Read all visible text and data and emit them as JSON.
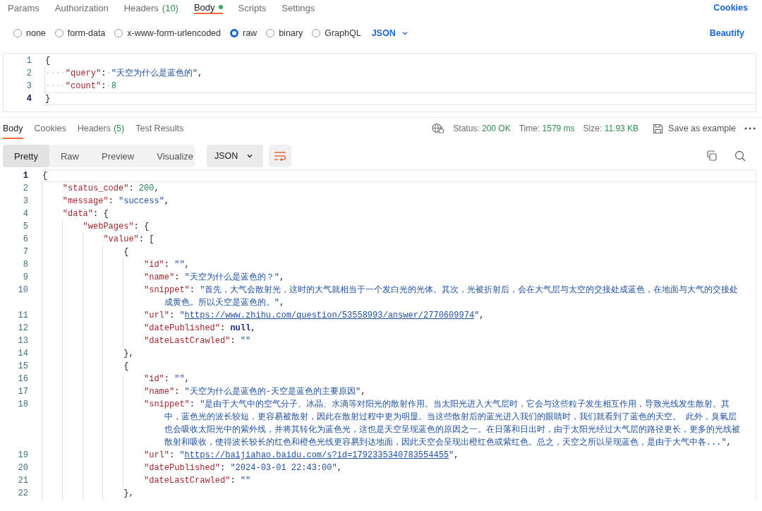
{
  "request_tabs": [
    {
      "label": "Params",
      "selected": false,
      "modified": false
    },
    {
      "label": "Authorization",
      "selected": false,
      "modified": false
    },
    {
      "label": "Headers",
      "count": "(10)",
      "selected": false,
      "modified": false
    },
    {
      "label": "Body",
      "selected": true,
      "modified": true
    },
    {
      "label": "Scripts",
      "selected": false,
      "modified": false
    },
    {
      "label": "Settings",
      "selected": false,
      "modified": false
    }
  ],
  "cookies_link": "Cookies",
  "body_types": [
    {
      "label": "none",
      "selected": false
    },
    {
      "label": "form-data",
      "selected": false
    },
    {
      "label": "x-www-form-urlencoded",
      "selected": false
    },
    {
      "label": "raw",
      "selected": true
    },
    {
      "label": "binary",
      "selected": false
    },
    {
      "label": "GraphQL",
      "selected": false
    }
  ],
  "body_format": "JSON",
  "beautify": "Beautify",
  "request_body": {
    "lines": [
      {
        "number": "1",
        "active": false,
        "tokens": [
          {
            "kind": "punct",
            "text": "{"
          }
        ]
      },
      {
        "number": "2",
        "active": false,
        "tokens": [
          {
            "kind": "whitespace",
            "text": "····"
          },
          {
            "kind": "key",
            "text": "\"query\""
          },
          {
            "kind": "punct",
            "text": ":"
          },
          {
            "kind": "whitespace",
            "text": "·"
          },
          {
            "kind": "string",
            "text": "\"天空为什么是蓝色的\""
          },
          {
            "kind": "punct",
            "text": ","
          }
        ]
      },
      {
        "number": "3",
        "active": false,
        "tokens": [
          {
            "kind": "whitespace",
            "text": "····"
          },
          {
            "kind": "key",
            "text": "\"count\""
          },
          {
            "kind": "punct",
            "text": ":"
          },
          {
            "kind": "whitespace",
            "text": "·"
          },
          {
            "kind": "number",
            "text": "8"
          }
        ]
      },
      {
        "number": "4",
        "active": true,
        "tokens": [
          {
            "kind": "punct",
            "text": "}"
          }
        ]
      }
    ]
  },
  "response_tabs": [
    {
      "label": "Body",
      "selected": true
    },
    {
      "label": "Cookies",
      "selected": false
    },
    {
      "label": "Headers",
      "count": "(5)",
      "selected": false
    },
    {
      "label": "Test Results",
      "selected": false
    }
  ],
  "status": {
    "status_label": "Status:",
    "status_value": "200 OK",
    "time_label": "Time:",
    "time_value": "1579 ms",
    "size_label": "Size:",
    "size_value": "11.93 KB"
  },
  "save_as_example": "Save as example",
  "view_modes": [
    {
      "label": "Pretty",
      "selected": true
    },
    {
      "label": "Raw",
      "selected": false
    },
    {
      "label": "Preview",
      "selected": false
    },
    {
      "label": "Visualize",
      "selected": false
    }
  ],
  "response_format": "JSON",
  "response_body": {
    "lines": [
      {
        "number": "1",
        "active": true,
        "tokens": [
          {
            "kind": "punct",
            "text": "{"
          }
        ]
      },
      {
        "number": "2",
        "active": false,
        "tokens": [
          {
            "kind": "key",
            "text": "\"status_code\""
          },
          {
            "kind": "punct",
            "text": ": "
          },
          {
            "kind": "number",
            "text": "200"
          },
          {
            "kind": "punct",
            "text": ","
          }
        ]
      },
      {
        "number": "3",
        "active": false,
        "tokens": [
          {
            "kind": "key",
            "text": "\"message\""
          },
          {
            "kind": "punct",
            "text": ": "
          },
          {
            "kind": "string",
            "text": "\"success\""
          },
          {
            "kind": "punct",
            "text": ","
          }
        ]
      },
      {
        "number": "4",
        "active": false,
        "tokens": [
          {
            "kind": "key",
            "text": "\"data\""
          },
          {
            "kind": "punct",
            "text": ": {"
          }
        ]
      },
      {
        "number": "5",
        "active": false,
        "tokens": [
          {
            "kind": "key",
            "text": "\"webPages\""
          },
          {
            "kind": "punct",
            "text": ": {"
          }
        ]
      },
      {
        "number": "6",
        "active": false,
        "tokens": [
          {
            "kind": "key",
            "text": "\"value\""
          },
          {
            "kind": "punct",
            "text": ": ["
          }
        ]
      },
      {
        "number": "7",
        "active": false,
        "tokens": [
          {
            "kind": "punct",
            "text": "{"
          }
        ]
      },
      {
        "number": "8",
        "active": false,
        "tokens": [
          {
            "kind": "key",
            "text": "\"id\""
          },
          {
            "kind": "punct",
            "text": ": "
          },
          {
            "kind": "string",
            "text": "\"\""
          },
          {
            "kind": "punct",
            "text": ","
          }
        ]
      },
      {
        "number": "9",
        "active": false,
        "tokens": [
          {
            "kind": "key",
            "text": "\"name\""
          },
          {
            "kind": "punct",
            "text": ": "
          },
          {
            "kind": "string",
            "text": "\"天空为什么是蓝色的？\""
          },
          {
            "kind": "punct",
            "text": ","
          }
        ]
      },
      {
        "number": "10",
        "active": false,
        "tokens": [
          {
            "kind": "key",
            "text": "\"snippet\""
          },
          {
            "kind": "punct",
            "text": ": "
          },
          {
            "kind": "string",
            "text": "\"首先，大气会散射光，这时的大气就相当于一个发白光的光体。其次，光被折射后，会在大气层与太空的交接处成蓝色，在地面与大气的交接处"
          }
        ]
      },
      {
        "active": false,
        "tokens": [
          {
            "kind": "string",
            "text": "成黄色。所以天空是蓝色的。\""
          },
          {
            "kind": "punct",
            "text": ","
          }
        ]
      },
      {
        "number": "11",
        "active": false,
        "tokens": [
          {
            "kind": "key",
            "text": "\"url\""
          },
          {
            "kind": "punct",
            "text": ": "
          },
          {
            "kind": "string",
            "text": "\""
          },
          {
            "kind": "link",
            "text": "https://www.zhihu.com/question/53558993/answer/2770609974"
          },
          {
            "kind": "string",
            "text": "\""
          },
          {
            "kind": "punct",
            "text": ","
          }
        ]
      },
      {
        "number": "12",
        "active": false,
        "tokens": [
          {
            "kind": "key",
            "text": "\"datePublished\""
          },
          {
            "kind": "punct",
            "text": ": "
          },
          {
            "kind": "literal",
            "text": "null"
          },
          {
            "kind": "punct",
            "text": ","
          }
        ]
      },
      {
        "number": "13",
        "active": false,
        "tokens": [
          {
            "kind": "key",
            "text": "\"dateLastCrawled\""
          },
          {
            "kind": "punct",
            "text": ": "
          },
          {
            "kind": "string",
            "text": "\"\""
          }
        ]
      },
      {
        "number": "14",
        "active": false,
        "tokens": [
          {
            "kind": "punct",
            "text": "},"
          }
        ]
      },
      {
        "number": "15",
        "active": false,
        "tokens": [
          {
            "kind": "punct",
            "text": "{"
          }
        ]
      },
      {
        "number": "16",
        "active": false,
        "tokens": [
          {
            "kind": "key",
            "text": "\"id\""
          },
          {
            "kind": "punct",
            "text": ": "
          },
          {
            "kind": "string",
            "text": "\"\""
          },
          {
            "kind": "punct",
            "text": ","
          }
        ]
      },
      {
        "number": "17",
        "active": false,
        "tokens": [
          {
            "kind": "key",
            "text": "\"name\""
          },
          {
            "kind": "punct",
            "text": ": "
          },
          {
            "kind": "string",
            "text": "\"天空为什么是蓝色的-天空是蓝色的主要原因\""
          },
          {
            "kind": "punct",
            "text": ","
          }
        ]
      },
      {
        "number": "18",
        "active": false,
        "tokens": [
          {
            "kind": "key",
            "text": "\"snippet\""
          },
          {
            "kind": "punct",
            "text": ": "
          },
          {
            "kind": "string",
            "text": "\"是由于大气中的空气分子、冰晶、水滴等对阳光的散射作用。当太阳光进入大气层时，它会与这些粒子发生相互作用，导致光线发生散射。其"
          }
        ]
      },
      {
        "active": false,
        "tokens": [
          {
            "kind": "string",
            "text": "中，蓝色光的波长较短，更容易被散射，因此在散射过程中更为明显。当这些散射后的蓝光进入我们的眼睛时，我们就看到了蓝色的天空。 此外，臭氧层"
          }
        ]
      },
      {
        "active": false,
        "tokens": [
          {
            "kind": "string",
            "text": "也会吸收太阳光中的紫外线，并将其转化为蓝色光，这也是天空呈现蓝色的原因之一。在日落和日出时，由于太阳光经过大气层的路径更长，更多的光线被"
          }
        ]
      },
      {
        "active": false,
        "tokens": [
          {
            "kind": "string",
            "text": "散射和吸收，使得波长较长的红色和橙色光线更容易到达地面，因此天空会呈现出橙红色或紫红色。总之，天空之所以呈现蓝色，是由于大气中各...\""
          },
          {
            "kind": "punct",
            "text": ","
          }
        ]
      },
      {
        "number": "19",
        "active": false,
        "tokens": [
          {
            "kind": "key",
            "text": "\"url\""
          },
          {
            "kind": "punct",
            "text": ": "
          },
          {
            "kind": "string",
            "text": "\""
          },
          {
            "kind": "link",
            "text": "https://baijiahao.baidu.com/s?id=1792335340783554455"
          },
          {
            "kind": "string",
            "text": "\""
          },
          {
            "kind": "punct",
            "text": ","
          }
        ]
      },
      {
        "number": "20",
        "active": false,
        "tokens": [
          {
            "kind": "key",
            "text": "\"datePublished\""
          },
          {
            "kind": "punct",
            "text": ": "
          },
          {
            "kind": "string",
            "text": "\"2024-03-01 22:43:00\""
          },
          {
            "kind": "punct",
            "text": ","
          }
        ]
      },
      {
        "number": "21",
        "active": false,
        "tokens": [
          {
            "kind": "key",
            "text": "\"dateLastCrawled\""
          },
          {
            "kind": "punct",
            "text": ": "
          },
          {
            "kind": "string",
            "text": "\"\""
          }
        ]
      },
      {
        "number": "22",
        "active": false,
        "tokens": [
          {
            "kind": "punct",
            "text": "},"
          }
        ]
      }
    ]
  }
}
